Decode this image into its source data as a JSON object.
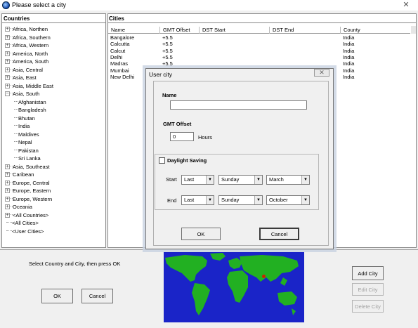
{
  "window": {
    "title": "Please select a city",
    "close_glyph": "✕"
  },
  "countries": {
    "header": "Countries",
    "items": [
      {
        "label": "Africa, Northen",
        "expandable": true
      },
      {
        "label": "Africa, Southern",
        "expandable": true
      },
      {
        "label": "Africa, Western",
        "expandable": true
      },
      {
        "label": "America, North",
        "expandable": true
      },
      {
        "label": "America, South",
        "expandable": true
      },
      {
        "label": "Asia, Central",
        "expandable": true
      },
      {
        "label": "Asia, East",
        "expandable": true
      },
      {
        "label": "Asia, Middle East",
        "expandable": true
      },
      {
        "label": "Asia, South",
        "expandable": true,
        "expanded": true
      },
      {
        "label": "Afghanistan",
        "child": true
      },
      {
        "label": "Bangladesh",
        "child": true
      },
      {
        "label": "Bhutan",
        "child": true
      },
      {
        "label": "India",
        "child": true
      },
      {
        "label": "Maldives",
        "child": true
      },
      {
        "label": "Nepal",
        "child": true
      },
      {
        "label": "Pakistan",
        "child": true
      },
      {
        "label": "Sri Lanka",
        "child": true
      },
      {
        "label": "Asia, Southeast",
        "expandable": true
      },
      {
        "label": "Caribean",
        "expandable": true
      },
      {
        "label": "Europe, Central",
        "expandable": true
      },
      {
        "label": "Europe, Eastern",
        "expandable": true
      },
      {
        "label": "Europe, Western",
        "expandable": true
      },
      {
        "label": "Oceania",
        "expandable": true
      },
      {
        "label": "<All Countries>",
        "expandable": true
      },
      {
        "label": "<All Cities>",
        "leaf": true
      },
      {
        "label": "<User Cities>",
        "leaf": true
      }
    ]
  },
  "cities": {
    "header": "Cities",
    "columns": [
      "Name",
      "GMT Offset",
      "DST Start",
      "DST End",
      "County"
    ],
    "rows": [
      [
        "Bangalore",
        "+5.5",
        "",
        "",
        "India"
      ],
      [
        "Calcutta",
        "+5.5",
        "",
        "",
        "India"
      ],
      [
        "Calcut",
        "+5.5",
        "",
        "",
        "India"
      ],
      [
        "Delhi",
        "+5.5",
        "",
        "",
        "India"
      ],
      [
        "Madras",
        "+5.5",
        "",
        "",
        "India"
      ],
      [
        "Mumbai",
        "+5.5",
        "",
        "",
        "India"
      ],
      [
        "New Delhi",
        "+5.5",
        "",
        "",
        "India"
      ]
    ]
  },
  "bottom": {
    "instruction": "Select Country and City, then press OK",
    "ok": "OK",
    "cancel": "Cancel",
    "add_city": "Add City",
    "edit_city": "Edit City",
    "delete_city": "Delete City"
  },
  "dialog": {
    "title": "User city",
    "close_glyph": "✕",
    "name_label": "Name",
    "name_value": "",
    "gmt_label": "GMT Offset",
    "gmt_value": "0",
    "gmt_unit": "Hours",
    "dst_label": "Daylight Saving",
    "dst_checked": false,
    "start_label": "Start",
    "end_label": "End",
    "start": {
      "week": "Last",
      "day": "Sunday",
      "month": "March"
    },
    "end": {
      "week": "Last",
      "day": "Sunday",
      "month": "October"
    },
    "ok": "OK",
    "cancel": "Cancel"
  },
  "colors": {
    "map_ocean": "#1a24c8",
    "map_land": "#22b022",
    "marker": "#cc2200"
  }
}
